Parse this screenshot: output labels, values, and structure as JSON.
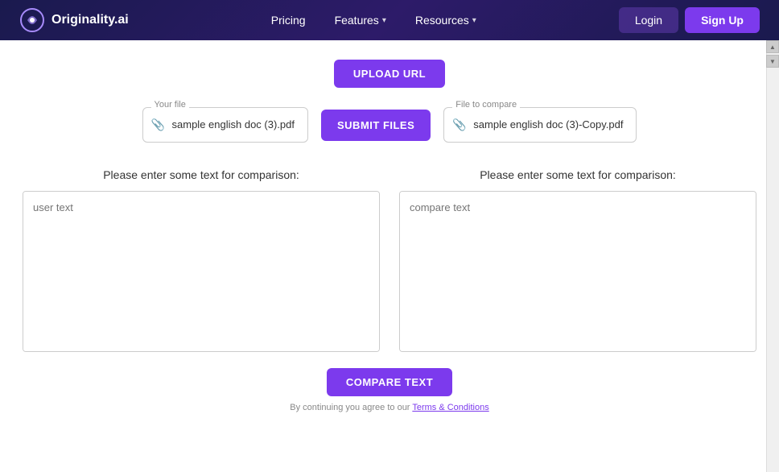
{
  "header": {
    "logo_text": "Originality.ai",
    "nav": [
      {
        "id": "pricing",
        "label": "Pricing",
        "hasChevron": false,
        "active": false
      },
      {
        "id": "features",
        "label": "Features",
        "hasChevron": true,
        "active": false
      },
      {
        "id": "resources",
        "label": "Resources",
        "hasChevron": true,
        "active": false
      }
    ],
    "login_label": "Login",
    "signup_label": "Sign Up"
  },
  "main": {
    "upload_url_label": "UPLOAD URL",
    "your_file_label": "Your file",
    "your_file_name": "sample english doc (3).pdf",
    "submit_files_label": "SUBMIT FILES",
    "file_to_compare_label": "File to compare",
    "compare_file_name": "sample english doc (3)-Copy.pdf",
    "text_prompt_left": "Please enter some text for comparison:",
    "text_prompt_right": "Please enter some text for comparison:",
    "user_text_placeholder": "user text",
    "compare_text_placeholder": "compare text",
    "compare_button_label": "COMPARE TEXT",
    "terms_text": "By continuing you agree to our ",
    "terms_link_text": "Terms & Conditions"
  }
}
